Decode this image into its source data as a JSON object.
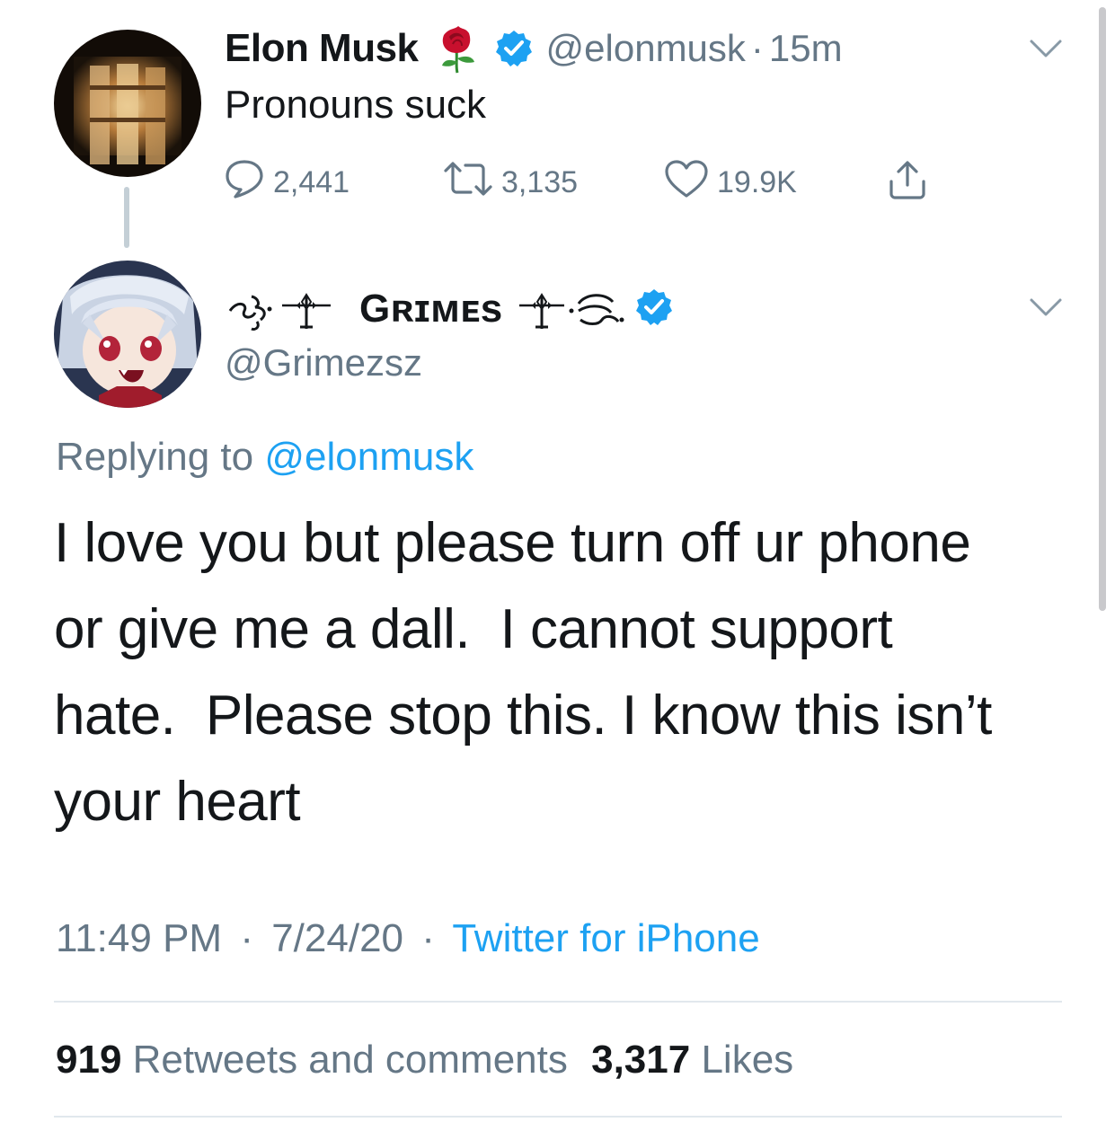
{
  "parent_tweet": {
    "display_name": "Elon Musk",
    "name_emoji": "rose-emoji",
    "handle": "@elonmusk",
    "separator": "·",
    "time_ago": "15m",
    "text": "Pronouns suck",
    "replies": "2,441",
    "retweets": "3,135",
    "likes": "19.9K"
  },
  "reply_tweet": {
    "display_name": "Gʀɪᴍᴇs",
    "handle": "@Grimezsz",
    "replying_prefix": "Replying to",
    "replying_handle": "@elonmusk",
    "text_lines": [
      "I love you but please turn off ur phone",
      "or give me a dall.  I cannot support",
      "hate.  Please stop this. I know this isn’t",
      "your heart"
    ],
    "time": "11:49 PM",
    "date": "7/24/20",
    "separator": "·",
    "source": "Twitter for iPhone",
    "retweets_count": "919",
    "retweets_label": "Retweets and comments",
    "likes_count": "3,317",
    "likes_label": "Likes"
  },
  "colors": {
    "link": "#1da1f2",
    "secondary_text": "#657786",
    "verified": "#1da1f2",
    "divider": "#e1e8ed"
  }
}
